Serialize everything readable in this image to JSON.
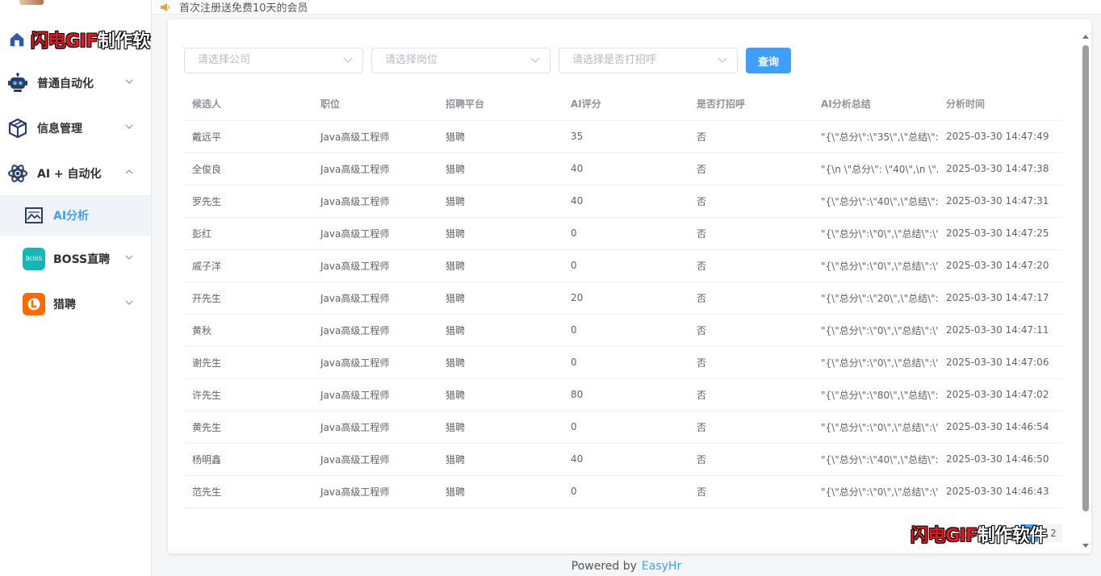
{
  "notice": {
    "text": "首次注册送免费10天的会员"
  },
  "watermark": {
    "red": "闪电GIF",
    "black": "制作软件"
  },
  "sidebar": {
    "items": [
      {
        "label": "普通自动化",
        "icon": "robot-icon"
      },
      {
        "label": "信息管理",
        "icon": "cube-icon"
      },
      {
        "label": "AI + 自动化",
        "icon": "atom-icon"
      },
      {
        "label": "AI分析",
        "icon": "chart-picture-icon"
      },
      {
        "label": "BOSS直聘",
        "icon": "boss-logo-icon",
        "badge": "BOSS"
      },
      {
        "label": "猎聘",
        "icon": "liepin-logo-icon"
      }
    ]
  },
  "filters": {
    "company_placeholder": "请选择公司",
    "position_placeholder": "请选择岗位",
    "greet_placeholder": "请选择是否打招呼",
    "query_label": "查询"
  },
  "table": {
    "headers": [
      "候选人",
      "职位",
      "招聘平台",
      "AI评分",
      "是否打招呼",
      "AI分析总结",
      "分析时间"
    ],
    "rows": [
      [
        "戴远平",
        "Java高级工程师",
        "猎聘",
        "35",
        "否",
        "\"{\\\"总分\\\":\\\"35\\\",\\\"总结\\\":\\\"",
        "2025-03-30 14:47:49"
      ],
      [
        "全俊良",
        "Java高级工程师",
        "猎聘",
        "40",
        "否",
        "\"{\\n \\\"总分\\\": \\\"40\\\",\\n \\\"总",
        "2025-03-30 14:47:38"
      ],
      [
        "罗先生",
        "Java高级工程师",
        "猎聘",
        "40",
        "否",
        "\"{\\\"总分\\\":\\\"40\\\",\\\"总结\\\":\\\"",
        "2025-03-30 14:47:31"
      ],
      [
        "彭红",
        "Java高级工程师",
        "猎聘",
        "0",
        "否",
        "\"{\\\"总分\\\":\\\"0\\\",\\\"总结\\\":\\\"",
        "2025-03-30 14:47:25"
      ],
      [
        "戚子洋",
        "Java高级工程师",
        "猎聘",
        "0",
        "否",
        "\"{\\\"总分\\\":\\\"0\\\",\\\"总结\\\":\\\"",
        "2025-03-30 14:47:20"
      ],
      [
        "开先生",
        "Java高级工程师",
        "猎聘",
        "20",
        "否",
        "\"{\\\"总分\\\":\\\"20\\\",\\\"总结\\\":\\\"",
        "2025-03-30 14:47:17"
      ],
      [
        "黄秋",
        "Java高级工程师",
        "猎聘",
        "0",
        "否",
        "\"{\\\"总分\\\":\\\"0\\\",\\\"总结\\\":\\\"",
        "2025-03-30 14:47:11"
      ],
      [
        "谢先生",
        "Java高级工程师",
        "猎聘",
        "0",
        "否",
        "\"{\\\"总分\\\":\\\"0\\\",\\\"总结\\\":\\\"",
        "2025-03-30 14:47:06"
      ],
      [
        "许先生",
        "Java高级工程师",
        "猎聘",
        "80",
        "否",
        "\"{\\\"总分\\\":\\\"80\\\",\\\"总结\\\":\\\"",
        "2025-03-30 14:47:02"
      ],
      [
        "黄先生",
        "Java高级工程师",
        "猎聘",
        "0",
        "否",
        "\"{\\\"总分\\\":\\\"0\\\",\\\"总结\\\":\\\"",
        "2025-03-30 14:46:54"
      ],
      [
        "杨明鑫",
        "Java高级工程师",
        "猎聘",
        "40",
        "否",
        "\"{\\\"总分\\\":\\\"40\\\",\\\"总结\\\":\\\"",
        "2025-03-30 14:46:50"
      ],
      [
        "范先生",
        "Java高级工程师",
        "猎聘",
        "0",
        "否",
        "\"{\\\"总分\\\":\\\"0\\\",\\\"总结\\\":\\\"",
        "2025-03-30 14:46:43"
      ]
    ]
  },
  "pagination": {
    "total": "共 103 条",
    "page1": "1",
    "page2": "2",
    "prev": "‹"
  },
  "footer": {
    "powered": "Powered by",
    "brand": "EasyHr"
  },
  "colors": {
    "accent": "#409eff",
    "liepin": "#ff6a00",
    "boss": "#15b6b6"
  }
}
